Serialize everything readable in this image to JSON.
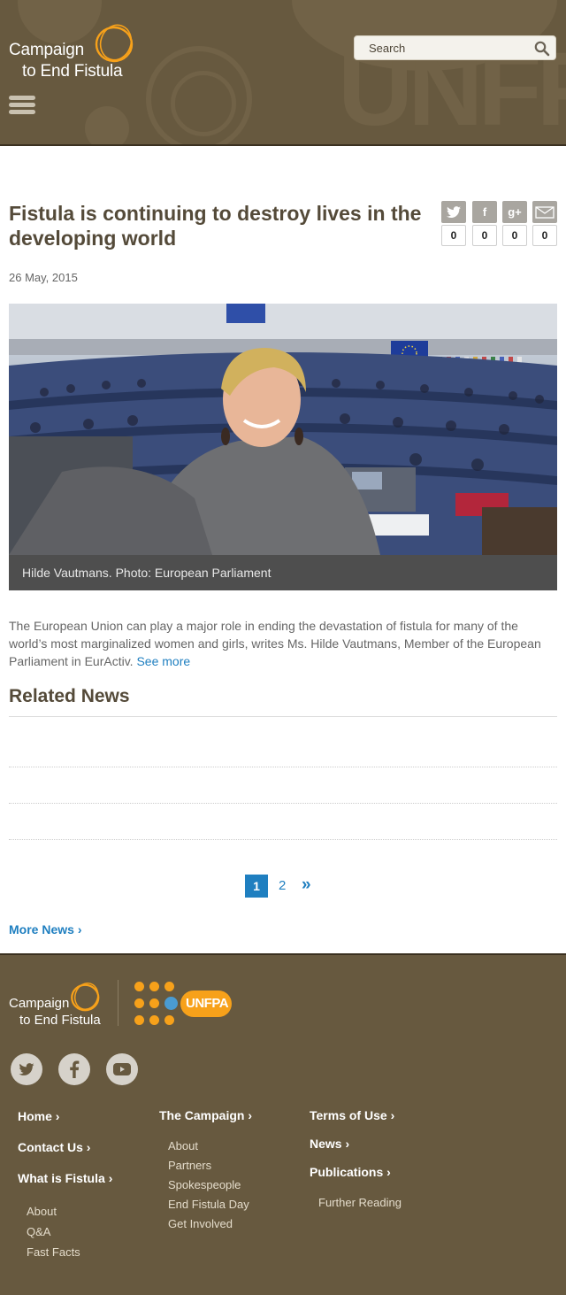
{
  "header": {
    "logo_line1": "Campaign",
    "logo_line2": "to End Fistula",
    "search_placeholder": "Search",
    "bg_text": "UNFPA"
  },
  "article": {
    "title": "Fistula is continuing to destroy lives in the developing world",
    "date": "26 May, 2015",
    "shares": [
      {
        "icon": "twitter-icon",
        "glyph": "t",
        "count": "0"
      },
      {
        "icon": "facebook-icon",
        "glyph": "f",
        "count": "0"
      },
      {
        "icon": "google-plus-icon",
        "glyph": "g+",
        "count": "0"
      },
      {
        "icon": "email-icon",
        "glyph": "✉",
        "count": "0"
      }
    ],
    "image_caption": "Hilde Vautmans. Photo: European Parliament",
    "body": "The European Union can play a major role in ending the devastation of fistula for many of the world’s most marginalized women and girls, writes Ms. Hilde Vautmans, Member of the European Parliament in EurActiv.",
    "see_more": "See more"
  },
  "related": {
    "heading": "Related News",
    "pages": [
      "1",
      "2"
    ],
    "current_page": "1",
    "next_label": "»",
    "more_news": "More News"
  },
  "footer": {
    "logo_line1": "Campaign",
    "logo_line2": "to End Fistula",
    "partner_logo": "UNFPA",
    "social": [
      "twitter-icon",
      "facebook-icon",
      "youtube-icon"
    ],
    "col1": {
      "links": [
        "Home",
        "Contact Us",
        "What is Fistula"
      ],
      "sub": [
        "About",
        "Q&A",
        "Fast Facts"
      ]
    },
    "col2": {
      "head": "The Campaign",
      "sub": [
        "About",
        "Partners",
        "Spokespeople",
        "End Fistula Day",
        "Get Involved"
      ]
    },
    "col3": {
      "links": [
        "Terms of Use",
        "News",
        "Publications"
      ],
      "sub": [
        "Further Reading"
      ]
    }
  },
  "colors": {
    "brand_brown": "#67593f",
    "accent_orange": "#f7a11a",
    "link_blue": "#1f7fc0"
  }
}
